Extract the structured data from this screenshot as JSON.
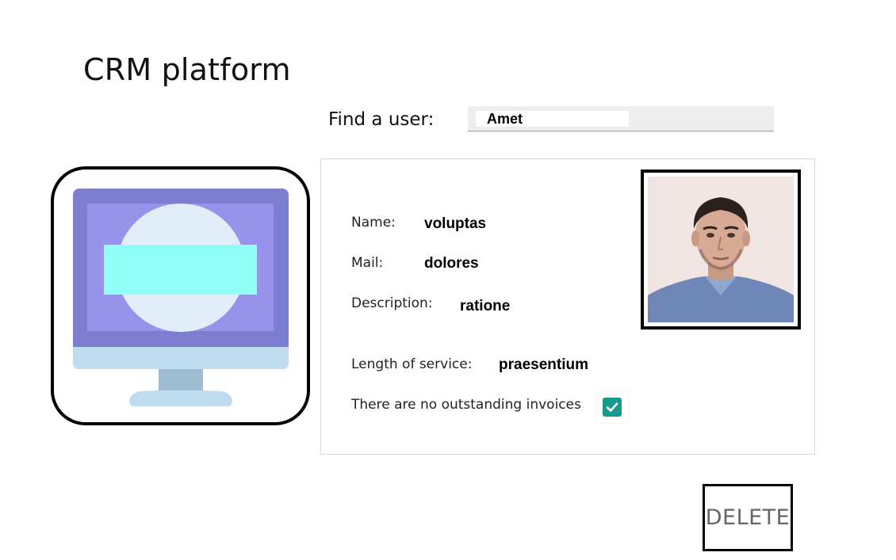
{
  "app": {
    "title": "CRM platform"
  },
  "search": {
    "label": "Find a user:",
    "value": "Amet"
  },
  "profile": {
    "name_label": "Name:",
    "name_value": "voluptas",
    "mail_label": "Mail:",
    "mail_value": "dolores",
    "description_label": "Description:",
    "description_value": "ratione",
    "service_label": "Length of service:",
    "service_value": "praesentium",
    "invoices_label": "There are no outstanding invoices",
    "invoices_checked": true
  },
  "actions": {
    "delete_label": "DELETE"
  },
  "icons": {
    "monitor": "computer-monitor-icon",
    "photo": "user-photo",
    "checkbox": "checkmark-icon"
  },
  "colors": {
    "checkbox_fill": "#159a8c",
    "monitor_body": "#7c7fd1",
    "monitor_screen": "#9793eb",
    "monitor_circle": "#e1edf9",
    "monitor_bar": "#8ffff8",
    "monitor_base": "#bfdbf0"
  }
}
